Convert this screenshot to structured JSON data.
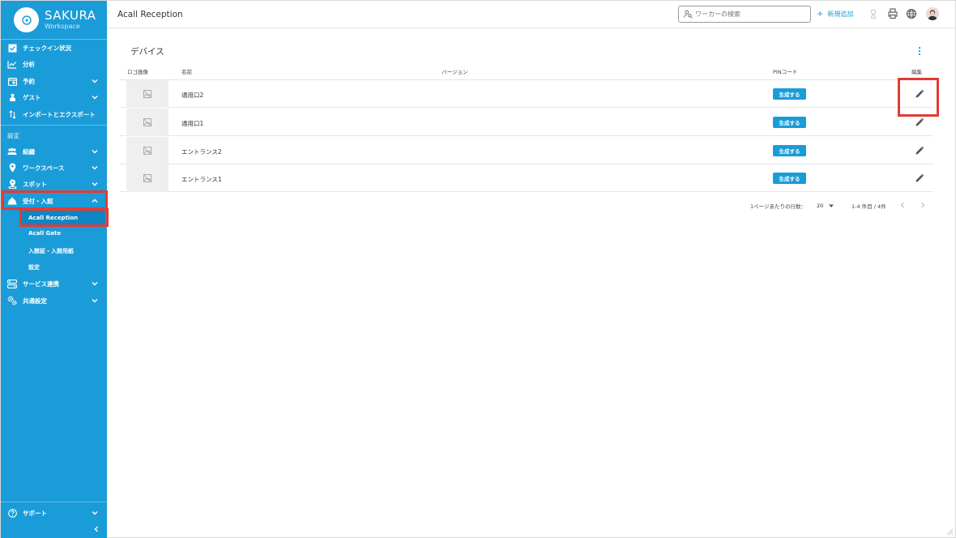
{
  "brand": {
    "name": "SAKURA",
    "sub": "Workspace"
  },
  "header": {
    "title": "Acall Reception",
    "search_placeholder": "ワーカーの検索",
    "add_new": "新規追加"
  },
  "sidebar": {
    "top_items": [
      {
        "label": "チェックイン状況",
        "icon": "checkbox-icon"
      },
      {
        "label": "分析",
        "icon": "chart-icon"
      },
      {
        "label": "予約",
        "icon": "calendar-icon",
        "expandable": true
      },
      {
        "label": "ゲスト",
        "icon": "guest-icon",
        "expandable": true
      },
      {
        "label": "インポートとエクスポート",
        "icon": "import-export-icon"
      }
    ],
    "settings_label": "設定",
    "settings_items": [
      {
        "label": "組織",
        "icon": "people-icon",
        "expandable": true
      },
      {
        "label": "ワークスペース",
        "icon": "location-pin-icon",
        "expandable": true
      },
      {
        "label": "スポット",
        "icon": "spot-icon",
        "expandable": true
      },
      {
        "label": "受付・入館",
        "icon": "reception-icon",
        "expandable": true,
        "expanded": true
      }
    ],
    "sub_items": [
      "Acall Reception",
      "Acall Gate",
      "入館証・入館用紙",
      "設定"
    ],
    "active_sub": "Acall Reception",
    "bottom_items": [
      {
        "label": "サービス連携",
        "icon": "integration-icon",
        "expandable": true
      },
      {
        "label": "共通設定",
        "icon": "gears-icon",
        "expandable": true
      }
    ],
    "support": "サポート"
  },
  "main": {
    "section_title": "デバイス",
    "columns": [
      "ロゴ画像",
      "名前",
      "バージョン",
      "PINコード",
      "編集"
    ],
    "rows": [
      {
        "name": "通用口2",
        "version": "",
        "pin_label": "生成する"
      },
      {
        "name": "通用口1",
        "version": "",
        "pin_label": "生成する"
      },
      {
        "name": "エントランス2",
        "version": "",
        "pin_label": "生成する"
      },
      {
        "name": "エントランス1",
        "version": "",
        "pin_label": "生成する"
      }
    ],
    "pagination": {
      "rows_per_page_label": "1ページあたりの行数：",
      "rows_per_page": "20",
      "range": "1-4 件目 / 4件"
    }
  },
  "colors": {
    "sidebar": "#1a9cd8",
    "accent": "#1a9cd8",
    "highlight": "#e33b33"
  }
}
